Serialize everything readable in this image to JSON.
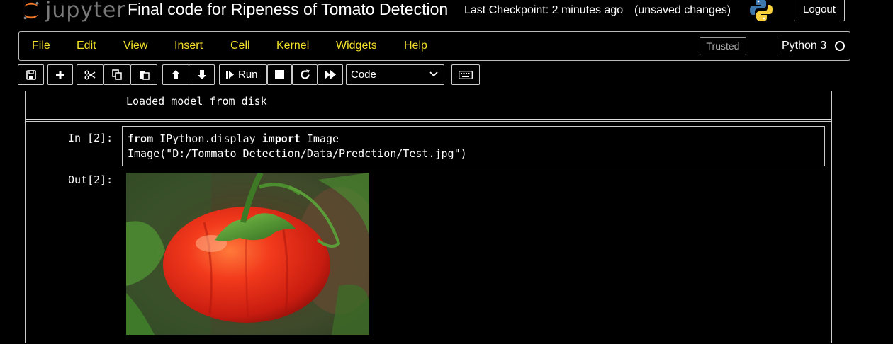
{
  "header": {
    "logo_text": "jupyter",
    "notebook_title": "Final code for Ripeness of Tomato Detection",
    "checkpoint": "Last Checkpoint: 2 minutes ago",
    "unsaved": "(unsaved changes)",
    "logout_label": "Logout"
  },
  "menu": {
    "items": [
      "File",
      "Edit",
      "View",
      "Insert",
      "Cell",
      "Kernel",
      "Widgets",
      "Help"
    ],
    "trusted_label": "Trusted",
    "kernel_name": "Python 3"
  },
  "toolbar": {
    "run_label": "Run",
    "cell_type": "Code",
    "icons": [
      "save-icon",
      "plus-icon",
      "cut-icon",
      "copy-icon",
      "paste-icon",
      "arrow-up-icon",
      "arrow-down-icon",
      "step-run-icon",
      "stop-icon",
      "restart-icon",
      "fast-forward-icon",
      "keyboard-icon"
    ]
  },
  "notebook": {
    "previous_output": "Loaded model from disk",
    "cell": {
      "in_prompt": "In [2]:",
      "code_line1_kw1": "from",
      "code_line1_mid": " IPython.display ",
      "code_line1_kw2": "import",
      "code_line1_end": " Image",
      "code_line2": "Image(\"D:/Tommato Detection/Data/Predction/Test.jpg\")",
      "out_prompt": "Out[2]:"
    }
  },
  "colors": {
    "menu_text": "#f5e12a",
    "background": "#000000",
    "tomato_red": "#e8291c",
    "leaf_green": "#3f8a2a"
  }
}
